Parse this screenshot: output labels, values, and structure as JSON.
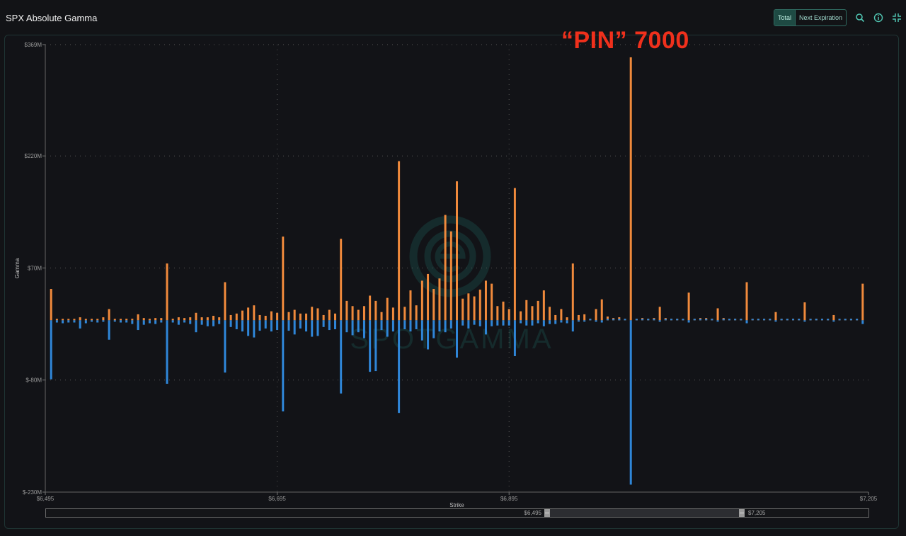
{
  "header": {
    "title": "SPX Absolute Gamma",
    "toggle": [
      "Total",
      "Next Expiration"
    ],
    "active_toggle": "Total",
    "icons": [
      "zoom-search-icon",
      "info-icon",
      "collapse-icon"
    ]
  },
  "annotation": "“PIN” 7000",
  "watermark": "SPOTGAMMA",
  "colors": {
    "calls": "#f08a3c",
    "puts": "#2f86d8",
    "accent": "#2f6b61",
    "annotation": "#f0301c"
  },
  "slider": {
    "min_label": "$6,495",
    "max_label": "$7,205",
    "range": [
      6495,
      7205
    ]
  },
  "chart_data": {
    "type": "bar",
    "title": "SPX Absolute Gamma",
    "xlabel": "Strike",
    "ylabel": "Gamma",
    "xlim": [
      6495,
      7205
    ],
    "ylim": [
      -230,
      369
    ],
    "y_unit": "M",
    "x_ticks": [
      "$6,495",
      "$6,695",
      "$6,895",
      "$7,205"
    ],
    "x_tick_values": [
      6495,
      6695,
      6895,
      7205
    ],
    "y_ticks": [
      "$369M",
      "$220M",
      "$70M",
      "$-80M",
      "$-230M"
    ],
    "y_tick_values": [
      369,
      220,
      70,
      -80,
      -230
    ],
    "grid": true,
    "strike_start": 6500,
    "strike_step": 5,
    "series": [
      {
        "color": "#f08a3c",
        "values": [
          42,
          0,
          0,
          0,
          0,
          4,
          0,
          0,
          0,
          4,
          15,
          0,
          0,
          2,
          2,
          8,
          3,
          2,
          3,
          3,
          76,
          2,
          4,
          3,
          4,
          10,
          4,
          4,
          6,
          4,
          51,
          7,
          9,
          13,
          17,
          20,
          7,
          6,
          12,
          10,
          112,
          11,
          14,
          9,
          9,
          18,
          16,
          7,
          14,
          9,
          109,
          26,
          19,
          14,
          19,
          33,
          26,
          11,
          30,
          17,
          213,
          18,
          40,
          20,
          53,
          62,
          42,
          56,
          141,
          119,
          186,
          29,
          36,
          32,
          41,
          53,
          49,
          19,
          25,
          15,
          177,
          12,
          27,
          19,
          26,
          40,
          18,
          7,
          15,
          4,
          76,
          7,
          8,
          2,
          15,
          28,
          5,
          3,
          4,
          1,
          352,
          1,
          3,
          2,
          3,
          18,
          3,
          2,
          2,
          1,
          37,
          1,
          3,
          3,
          2,
          16,
          3,
          1,
          2,
          1,
          51,
          1,
          2,
          1,
          2,
          11,
          1,
          0,
          2,
          0,
          24,
          0,
          2,
          0,
          1,
          7,
          1,
          0,
          2,
          0,
          49
        ]
      },
      {
        "color": "#2f86d8",
        "values": [
          -79,
          -3,
          -4,
          -3,
          -3,
          -11,
          -4,
          -2,
          -3,
          -2,
          -26,
          -1,
          -3,
          -3,
          -5,
          -13,
          -6,
          -4,
          -5,
          -3,
          -85,
          -3,
          -6,
          -3,
          -5,
          -16,
          -6,
          -8,
          -8,
          -5,
          -70,
          -9,
          -12,
          -15,
          -21,
          -23,
          -14,
          -11,
          -15,
          -13,
          -122,
          -14,
          -19,
          -11,
          -15,
          -22,
          -21,
          -9,
          -13,
          -12,
          -98,
          -16,
          -20,
          -16,
          -24,
          -69,
          -68,
          -13,
          -22,
          -15,
          -124,
          -12,
          -15,
          -12,
          -27,
          -39,
          -24,
          -15,
          -16,
          -11,
          -50,
          -7,
          -11,
          -6,
          -8,
          -19,
          -8,
          -7,
          -7,
          -7,
          -48,
          -4,
          -7,
          -7,
          -4,
          -8,
          -5,
          -5,
          -3,
          -4,
          -15,
          -1,
          -1,
          0,
          -2,
          -3,
          0,
          0,
          0,
          0,
          -220,
          0,
          0,
          0,
          0,
          -2,
          0,
          0,
          0,
          0,
          -3,
          0,
          0,
          0,
          0,
          -1,
          0,
          0,
          0,
          0,
          -4,
          0,
          0,
          0,
          0,
          -1,
          0,
          0,
          0,
          0,
          -1,
          0,
          0,
          0,
          0,
          -1,
          0,
          0,
          0,
          0,
          -5
        ]
      }
    ]
  }
}
